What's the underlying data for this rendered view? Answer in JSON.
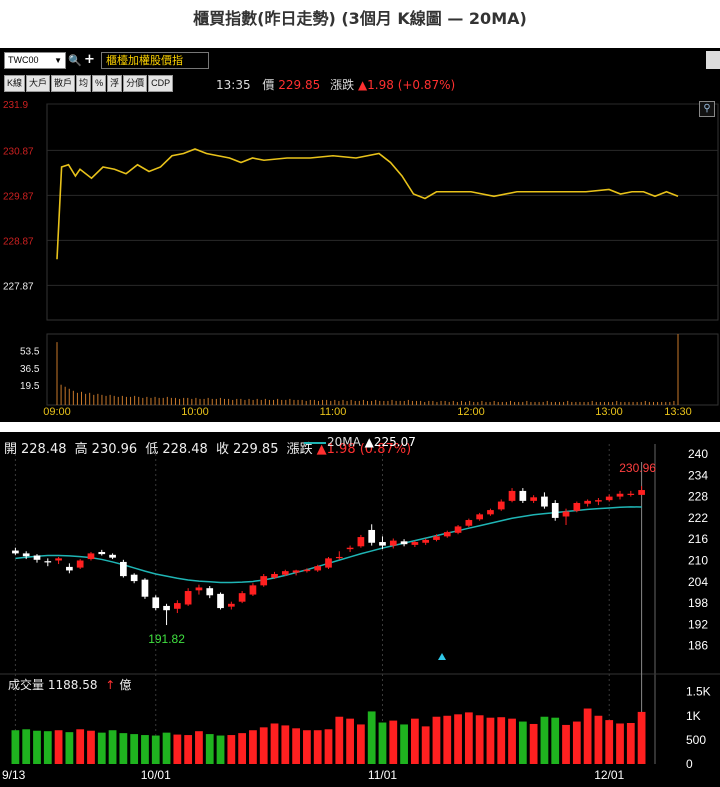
{
  "page": {
    "title": "櫃買指數(昨日走勢) (3個月 K線圖  — 20MA)"
  },
  "intraday": {
    "symbol": "TWC00",
    "name": "櫃檯加權股價指",
    "tabs": [
      "K線",
      "大戶",
      "散戶",
      "均",
      "%",
      "浮",
      "分價",
      "CDP"
    ],
    "quote": {
      "time": "13:35",
      "price_label": "價",
      "price": "229.85",
      "change_label": "漲跌",
      "change": "▲1.98 (+0.87%)"
    },
    "colors": {
      "price_line": "#e8c21a",
      "volume_bar": "#c8782a",
      "axis_text": "#cc2020",
      "time_text": "#e8c21a"
    },
    "chart_data": {
      "type": "line",
      "title": "",
      "ylim": [
        227.1,
        231.9
      ],
      "y_ticks": [
        "231.9",
        "230.87",
        "229.87",
        "228.87",
        "227.87"
      ],
      "x_ticks": [
        "09:00",
        "10:00",
        "11:00",
        "12:00",
        "13:00",
        "13:30"
      ],
      "series": [
        {
          "x": [
            "09:00",
            "09:02",
            "09:05",
            "09:08",
            "09:10",
            "09:15",
            "09:20",
            "09:25",
            "09:30",
            "09:35",
            "09:40",
            "09:45",
            "09:50",
            "09:55",
            "10:00",
            "10:05",
            "10:10",
            "10:15",
            "10:20",
            "10:25",
            "10:30",
            "10:40",
            "10:50",
            "11:00",
            "11:10",
            "11:20",
            "11:25",
            "11:30",
            "11:35",
            "11:40",
            "11:45",
            "11:50",
            "12:00",
            "12:10",
            "12:20",
            "12:30",
            "12:40",
            "12:50",
            "13:00",
            "13:05",
            "13:10",
            "13:15",
            "13:20",
            "13:25",
            "13:30"
          ],
          "y": [
            228.45,
            230.5,
            230.55,
            230.3,
            230.45,
            230.25,
            230.5,
            230.45,
            230.35,
            230.55,
            230.4,
            230.5,
            230.75,
            230.8,
            230.9,
            230.8,
            230.75,
            230.7,
            230.6,
            230.7,
            230.65,
            230.7,
            230.7,
            230.75,
            230.7,
            230.8,
            230.6,
            230.3,
            229.9,
            229.8,
            229.95,
            229.95,
            229.95,
            229.85,
            229.95,
            229.95,
            229.95,
            229.95,
            230.0,
            229.9,
            229.95,
            229.95,
            229.85,
            229.95,
            229.85
          ]
        }
      ],
      "volume": {
        "ylabels": [
          "53.5",
          "36.5",
          "19.5"
        ],
        "ylim": [
          0,
          70
        ],
        "values": [
          62,
          20,
          18,
          16,
          14,
          12,
          13,
          11,
          12,
          10,
          11,
          10,
          9,
          10,
          9,
          8,
          9,
          8,
          8,
          9,
          8,
          7,
          8,
          7,
          8,
          7,
          7,
          8,
          7,
          7,
          6,
          7,
          7,
          6,
          7,
          6,
          6,
          7,
          6,
          6,
          7,
          6,
          6,
          5,
          6,
          6,
          5,
          6,
          5,
          6,
          5,
          6,
          5,
          5,
          6,
          5,
          5,
          6,
          5,
          5,
          5,
          4,
          5,
          5,
          4,
          5,
          5,
          4,
          5,
          4,
          5,
          4,
          5,
          4,
          4,
          5,
          4,
          4,
          5,
          4,
          4,
          4,
          5,
          4,
          4,
          4,
          5,
          4,
          4,
          4,
          3,
          4,
          4,
          3,
          4,
          4,
          3,
          4,
          3,
          4,
          3,
          4,
          3,
          3,
          4,
          3,
          3,
          4,
          3,
          3,
          3,
          4,
          3,
          3,
          3,
          4,
          3,
          3,
          3,
          3,
          4,
          3,
          3,
          3,
          3,
          4,
          3,
          3,
          3,
          3,
          3,
          4,
          3,
          3,
          3,
          3,
          3,
          4,
          3,
          3,
          3,
          3,
          3,
          3,
          4,
          3,
          3,
          3,
          3,
          3,
          3,
          4,
          70
        ]
      }
    }
  },
  "kline": {
    "ohlc": {
      "open_label": "開",
      "open": "228.48",
      "high_label": "高",
      "high": "230.96",
      "low_label": "低",
      "low": "228.48",
      "close_label": "收",
      "close": "229.85",
      "change_label": "漲跌",
      "change": "▲1.98 (0.87%)"
    },
    "ma_legend": {
      "label": "20MA",
      "value": "▲225.07"
    },
    "volume_legend": {
      "label": "成交量",
      "value": "1188.58",
      "arrow": "↑",
      "unit": "億"
    },
    "annotations": {
      "high": "230.96",
      "low": "191.82"
    },
    "colors": {
      "up": "#ff2020",
      "down": "#ffffff",
      "ma": "#1fb5b5",
      "vol_up": "#ff2020",
      "vol_down": "#1fb31f",
      "axis_text": "#ffffff"
    },
    "chart_data": {
      "type": "candlestick",
      "title": "",
      "ylim": [
        180,
        240
      ],
      "y_ticks": [
        "240",
        "234",
        "228",
        "222",
        "216",
        "210",
        "204",
        "198",
        "192",
        "186"
      ],
      "x_ticks": [
        "9/13",
        "10/01",
        "11/01",
        "12/01"
      ],
      "x_tick_index": [
        0,
        13,
        34,
        55
      ],
      "candles": [
        {
          "o": 212.8,
          "h": 213.6,
          "l": 211.6,
          "c": 212.0
        },
        {
          "o": 212.0,
          "h": 212.6,
          "l": 210.4,
          "c": 211.2
        },
        {
          "o": 211.4,
          "h": 211.8,
          "l": 209.4,
          "c": 210.2
        },
        {
          "o": 209.8,
          "h": 210.6,
          "l": 208.4,
          "c": 209.6
        },
        {
          "o": 210.0,
          "h": 211.0,
          "l": 209.0,
          "c": 210.6
        },
        {
          "o": 208.2,
          "h": 209.2,
          "l": 206.4,
          "c": 207.2
        },
        {
          "o": 208.0,
          "h": 210.4,
          "l": 207.6,
          "c": 210.0
        },
        {
          "o": 210.4,
          "h": 212.4,
          "l": 210.0,
          "c": 212.0
        },
        {
          "o": 212.4,
          "h": 213.0,
          "l": 211.4,
          "c": 211.8
        },
        {
          "o": 211.6,
          "h": 212.0,
          "l": 210.4,
          "c": 210.8
        },
        {
          "o": 209.6,
          "h": 210.2,
          "l": 205.2,
          "c": 205.6
        },
        {
          "o": 206.0,
          "h": 206.4,
          "l": 203.6,
          "c": 204.2
        },
        {
          "o": 204.6,
          "h": 205.0,
          "l": 199.2,
          "c": 199.8
        },
        {
          "o": 199.6,
          "h": 200.2,
          "l": 196.0,
          "c": 196.6
        },
        {
          "o": 197.2,
          "h": 197.8,
          "l": 191.82,
          "c": 196.0
        },
        {
          "o": 196.4,
          "h": 198.8,
          "l": 195.2,
          "c": 198.0
        },
        {
          "o": 197.6,
          "h": 202.2,
          "l": 197.2,
          "c": 201.4
        },
        {
          "o": 201.6,
          "h": 203.2,
          "l": 200.4,
          "c": 202.4
        },
        {
          "o": 202.2,
          "h": 202.8,
          "l": 199.4,
          "c": 200.2
        },
        {
          "o": 200.6,
          "h": 201.0,
          "l": 196.2,
          "c": 196.6
        },
        {
          "o": 197.0,
          "h": 198.4,
          "l": 196.2,
          "c": 197.8
        },
        {
          "o": 198.4,
          "h": 201.4,
          "l": 198.0,
          "c": 200.8
        },
        {
          "o": 200.4,
          "h": 203.6,
          "l": 200.0,
          "c": 203.0
        },
        {
          "o": 203.0,
          "h": 206.2,
          "l": 202.6,
          "c": 205.6
        },
        {
          "o": 205.2,
          "h": 206.8,
          "l": 204.8,
          "c": 206.2
        },
        {
          "o": 206.0,
          "h": 207.4,
          "l": 205.6,
          "c": 207.0
        },
        {
          "o": 206.6,
          "h": 207.4,
          "l": 205.8,
          "c": 207.2
        },
        {
          "o": 207.0,
          "h": 207.8,
          "l": 206.6,
          "c": 207.4
        },
        {
          "o": 207.2,
          "h": 208.8,
          "l": 206.8,
          "c": 208.4
        },
        {
          "o": 208.0,
          "h": 211.0,
          "l": 207.6,
          "c": 210.6
        },
        {
          "o": 210.8,
          "h": 212.6,
          "l": 210.2,
          "c": 211.0
        },
        {
          "o": 213.2,
          "h": 214.2,
          "l": 212.4,
          "c": 213.6
        },
        {
          "o": 214.0,
          "h": 217.2,
          "l": 213.6,
          "c": 216.6
        },
        {
          "o": 218.6,
          "h": 220.2,
          "l": 214.2,
          "c": 215.0
        },
        {
          "o": 215.2,
          "h": 216.8,
          "l": 213.2,
          "c": 214.2
        },
        {
          "o": 214.2,
          "h": 216.2,
          "l": 213.4,
          "c": 215.6
        },
        {
          "o": 215.4,
          "h": 216.0,
          "l": 214.0,
          "c": 214.6
        },
        {
          "o": 214.4,
          "h": 215.6,
          "l": 213.8,
          "c": 215.2
        },
        {
          "o": 215.0,
          "h": 216.2,
          "l": 214.4,
          "c": 215.8
        },
        {
          "o": 215.8,
          "h": 217.4,
          "l": 215.4,
          "c": 216.8
        },
        {
          "o": 216.8,
          "h": 218.4,
          "l": 216.4,
          "c": 218.0
        },
        {
          "o": 217.8,
          "h": 220.0,
          "l": 217.4,
          "c": 219.6
        },
        {
          "o": 219.8,
          "h": 221.8,
          "l": 219.4,
          "c": 221.4
        },
        {
          "o": 221.6,
          "h": 223.4,
          "l": 221.2,
          "c": 223.0
        },
        {
          "o": 223.0,
          "h": 224.6,
          "l": 222.6,
          "c": 224.2
        },
        {
          "o": 224.4,
          "h": 227.2,
          "l": 224.0,
          "c": 226.6
        },
        {
          "o": 226.8,
          "h": 230.4,
          "l": 226.4,
          "c": 229.6
        },
        {
          "o": 229.6,
          "h": 230.4,
          "l": 226.2,
          "c": 226.8
        },
        {
          "o": 226.8,
          "h": 228.4,
          "l": 226.2,
          "c": 227.8
        },
        {
          "o": 228.0,
          "h": 229.2,
          "l": 224.6,
          "c": 225.2
        },
        {
          "o": 226.2,
          "h": 227.0,
          "l": 221.2,
          "c": 222.0
        },
        {
          "o": 222.4,
          "h": 224.6,
          "l": 220.0,
          "c": 223.8
        },
        {
          "o": 224.0,
          "h": 226.6,
          "l": 223.6,
          "c": 226.2
        },
        {
          "o": 226.0,
          "h": 227.2,
          "l": 225.2,
          "c": 226.8
        },
        {
          "o": 226.6,
          "h": 227.6,
          "l": 225.6,
          "c": 227.0
        },
        {
          "o": 227.0,
          "h": 228.6,
          "l": 226.6,
          "c": 228.0
        },
        {
          "o": 228.0,
          "h": 229.6,
          "l": 227.2,
          "c": 228.8
        },
        {
          "o": 228.6,
          "h": 229.6,
          "l": 228.0,
          "c": 228.8
        },
        {
          "o": 228.48,
          "h": 230.96,
          "l": 228.48,
          "c": 229.85
        }
      ],
      "ma20": [
        210.6,
        210.9,
        211.2,
        211.4,
        211.4,
        211.3,
        211.1,
        210.8,
        210.3,
        209.6,
        208.8,
        207.9,
        207.0,
        206.2,
        205.6,
        205.0,
        204.5,
        204.2,
        204.0,
        203.8,
        203.8,
        203.9,
        204.1,
        204.5,
        205.1,
        205.8,
        206.6,
        207.4,
        208.3,
        209.2,
        210.1,
        211.0,
        211.9,
        212.7,
        213.5,
        214.2,
        214.9,
        215.6,
        216.3,
        217.0,
        217.7,
        218.4,
        219.1,
        219.8,
        220.5,
        221.2,
        221.9,
        222.4,
        222.9,
        223.2,
        223.5,
        223.8,
        224.1,
        224.4,
        224.6,
        224.8,
        225.0,
        225.1,
        225.07
      ],
      "volume": {
        "ylim": [
          0,
          1700
        ],
        "y_ticks": [
          "1.5K",
          "1K",
          "500",
          "0"
        ],
        "values": [
          700,
          720,
          690,
          680,
          700,
          660,
          720,
          690,
          650,
          700,
          640,
          620,
          600,
          590,
          650,
          610,
          600,
          680,
          620,
          590,
          600,
          640,
          700,
          760,
          840,
          800,
          740,
          700,
          700,
          720,
          980,
          940,
          820,
          1090,
          860,
          900,
          820,
          940,
          780,
          980,
          1000,
          1030,
          1070,
          1010,
          960,
          970,
          940,
          880,
          830,
          980,
          960,
          810,
          880,
          1150,
          1000,
          910,
          840,
          850,
          1080
        ]
      }
    }
  }
}
